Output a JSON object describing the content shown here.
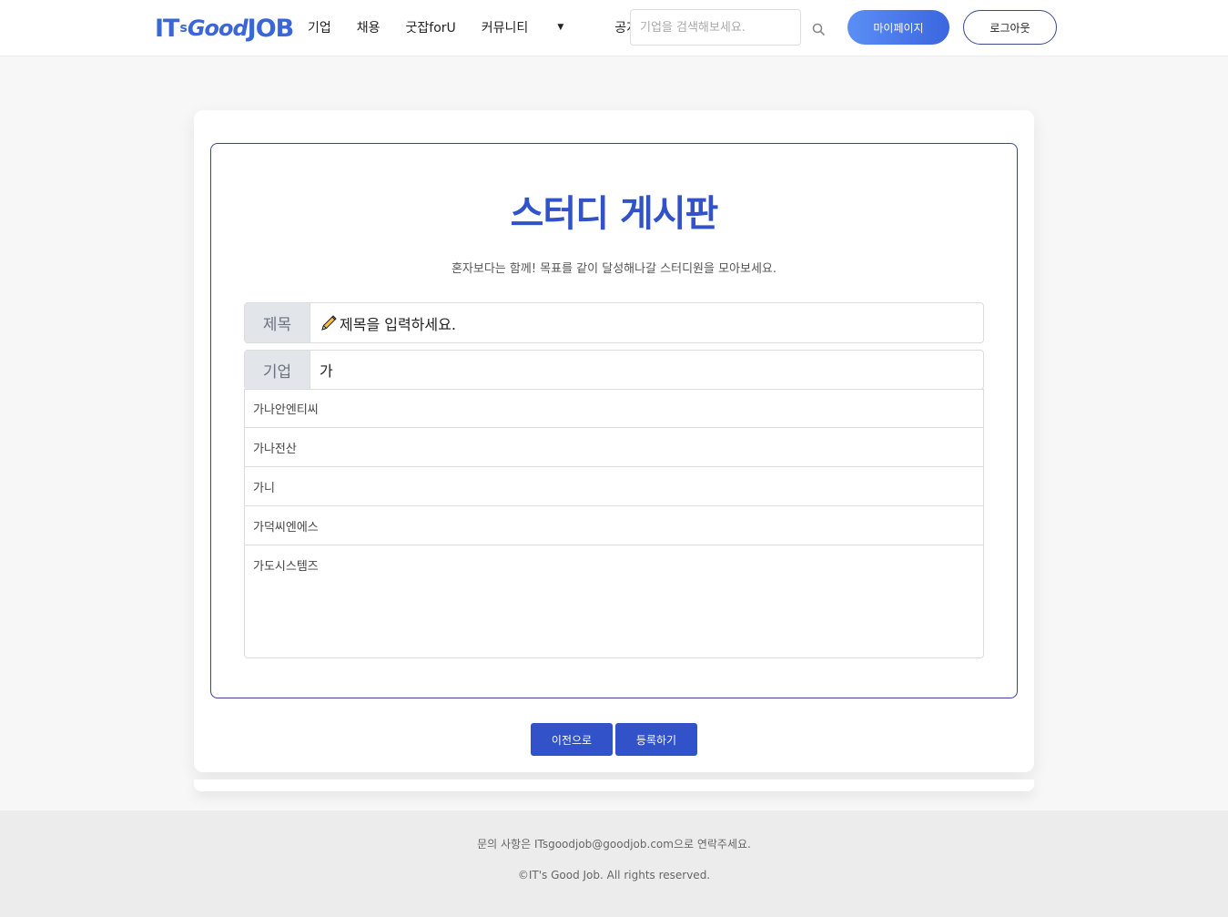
{
  "header": {
    "logo": {
      "part1": "IT",
      "part2": "s",
      "part3": "Good",
      "part4": "JOB"
    },
    "nav": [
      "기업",
      "채용",
      "굿잡forU",
      "커뮤니티",
      "공지사항"
    ],
    "search_placeholder": "기업을 검색해보세요.",
    "mypage_label": "마이페이지",
    "logout_label": "로그아웃"
  },
  "main": {
    "title": "스터디 게시판",
    "subtitle": "혼자보다는 함께! 목표를 같이 달성해나갈 스터디원을 모아보세요.",
    "fields": {
      "title_label": "제목",
      "title_placeholder": "제목을 입력하세요.",
      "company_label": "기업",
      "company_value": "가"
    },
    "suggestions": [
      "가나안엔티씨",
      "가나전산",
      "가니",
      "가덕씨엔에스",
      "가도시스템즈"
    ],
    "buttons": {
      "prev": "이전으로",
      "submit": "등록하기"
    }
  },
  "footer": {
    "contact": "문의 사항은 ITsgoodjob@goodjob.com으로 연락주세요.",
    "copyright": "©IT's Good Job. All rights reserved."
  },
  "colors": {
    "accent": "#3152c8",
    "brand": "#3b66d8",
    "border": "#3d3fa8"
  },
  "icons": [
    "search-icon",
    "pencil-icon",
    "chevron-down-icon"
  ]
}
